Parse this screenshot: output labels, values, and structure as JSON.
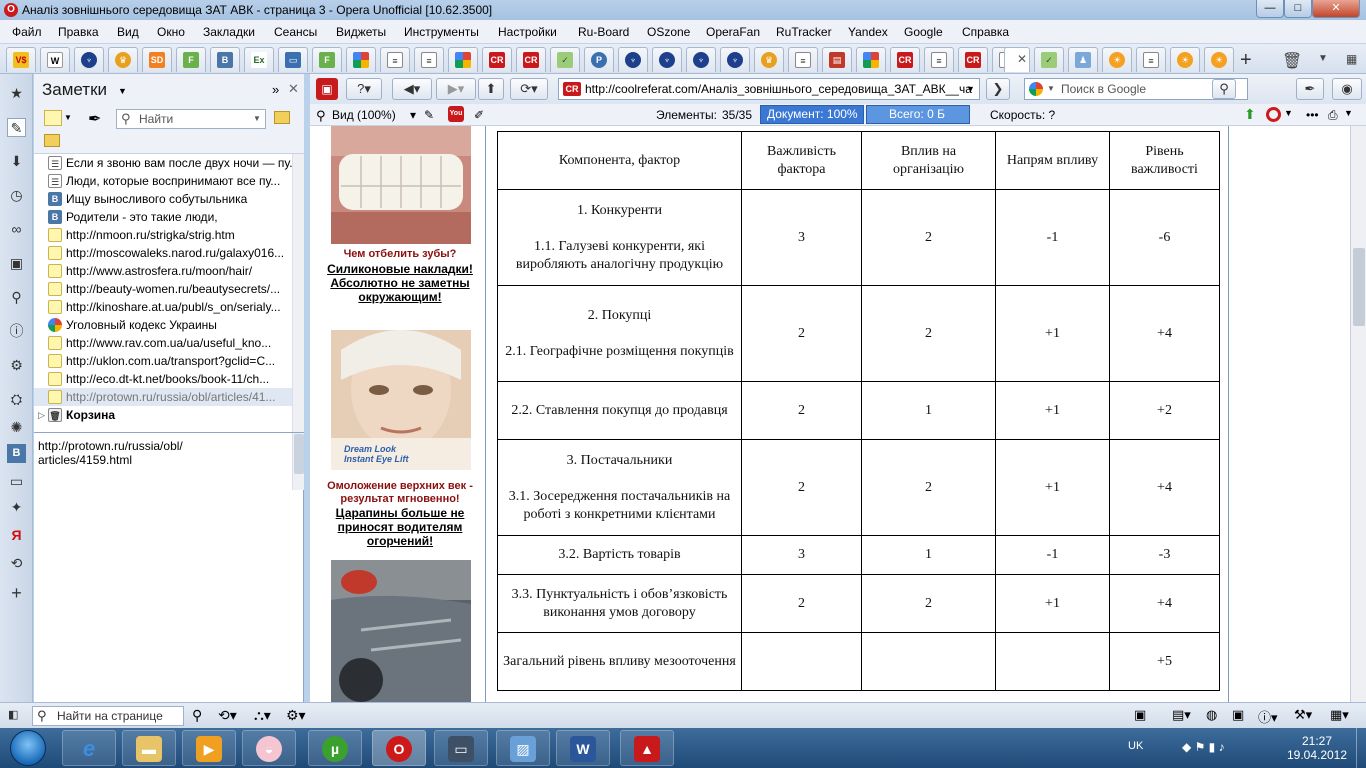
{
  "window": {
    "title": "Аналіз зовнішнього середовища ЗАТ АВК - страница 3 - Opera Unofficial [10.62.3500]"
  },
  "menu": [
    "Файл",
    "Правка",
    "Вид",
    "Окно",
    "Закладки",
    "Сеансы",
    "Виджеты",
    "Инструменты",
    "Настройки",
    "Ru-Board",
    "OSzone",
    "OperaFan",
    "RuTracker",
    "Yandex",
    "Google",
    "Справка"
  ],
  "tabs": [
    "V$",
    "W",
    "",
    "",
    "SD",
    "F",
    "B",
    "Ex",
    "",
    "F",
    "",
    "",
    "",
    "",
    "CR",
    "CR",
    "",
    "P",
    "",
    "",
    "",
    "",
    "",
    "",
    "",
    "",
    "",
    "",
    "CR",
    "",
    "CR",
    "",
    ""
  ],
  "notes": {
    "title": "Заметки",
    "search_placeholder": "Найти",
    "items": [
      "Если я звоню вам после двух ночи — пу...",
      "Люди, которые воспринимают все пу...",
      "Ищу выносливого собутыльника",
      "Родители - это такие люди,",
      "http://nmoon.ru/strigka/strig.htm",
      "http://moscowaleks.narod.ru/galaxy016...",
      "http://www.astrosfera.ru/moon/hair/",
      "http://beauty-women.ru/beautysecrets/...",
      "http://kinoshare.at.ua/publ/s_on/serialy...",
      "Уголовный кодекс Украины",
      "http://www.rav.com.ua/ua/useful_kno...",
      "http://uklon.com.ua/transport?gclid=C...",
      "http://eco.dt-kt.net/books/book-11/ch...",
      "http://protown.ru/russia/obl/articles/41..."
    ],
    "trash": "Корзина",
    "detail_line1": "http://protown.ru/russia/obl/",
    "detail_line2": "articles/4159.html"
  },
  "address": {
    "url": "http://coolreferat.com/Аналіз_зовнішнього_середовища_ЗАТ_АВК__ча",
    "search_placeholder": "Поиск в Google"
  },
  "infobar": {
    "view": "Вид (100%)",
    "elements_label": "Элементы:",
    "elements_value": "35/35",
    "document": "Документ:  100%",
    "total": "Всего:   0 Б",
    "speed": "Скорость:   ?"
  },
  "ads": [
    {
      "question": "Чем отбелить зубы?",
      "link": "Силиконовые накладки! Абсолютно не заметны окружающим!"
    },
    {
      "question": "Омоложение верхних век - результат мгновенно!",
      "link": "Царапины больше не приносят водителям огорчений!",
      "image_caption_1": "Dream Look",
      "image_caption_2": "Instant Eye Lift"
    }
  ],
  "table": {
    "headers": [
      "Компонента, фактор",
      "Важливість фактора",
      "Вплив на організацію",
      "Напрям впливу",
      "Рівень важливості"
    ],
    "rows": [
      {
        "factor_line1": "1. Конкуренти",
        "factor_line2": "1.1. Галузеві конкуренти, які виробляють аналогічну продукцію",
        "importance": "3",
        "influence": "2",
        "direction": "-1",
        "level": "-6"
      },
      {
        "factor_line1": "2. Покупці",
        "factor_line2": "2.1. Географічне розміщення покупців",
        "importance": "2",
        "influence": "2",
        "direction": "+1",
        "level": "+4"
      },
      {
        "factor_line1": "",
        "factor_line2": "2.2. Ставлення покупця до продавця",
        "importance": "2",
        "influence": "1",
        "direction": "+1",
        "level": "+2"
      },
      {
        "factor_line1": "3. Постачальники",
        "factor_line2": "3.1. Зосередження постачальників на роботі з конкретними клієнтами",
        "importance": "2",
        "influence": "2",
        "direction": "+1",
        "level": "+4"
      },
      {
        "factor_line1": "",
        "factor_line2": "3.2. Вартість товарів",
        "importance": "3",
        "influence": "1",
        "direction": "-1",
        "level": "-3"
      },
      {
        "factor_line1": "",
        "factor_line2": "3.3. Пунктуальність і обов’язковість виконання умов договору",
        "importance": "2",
        "influence": "2",
        "direction": "+1",
        "level": "+4"
      },
      {
        "factor_line1": "",
        "factor_line2": "Загальний рівень впливу мезооточення",
        "importance": "",
        "influence": "",
        "direction": "",
        "level": "+5"
      }
    ]
  },
  "bottom": {
    "find_placeholder": "Найти на странице"
  },
  "taskbar": {
    "lang": "UK",
    "time": "21:27",
    "date": "19.04.2012"
  },
  "colors": {
    "accent": "#3a78d4",
    "opera_red": "#cc1a1a",
    "ad_red": "#8b1010"
  }
}
